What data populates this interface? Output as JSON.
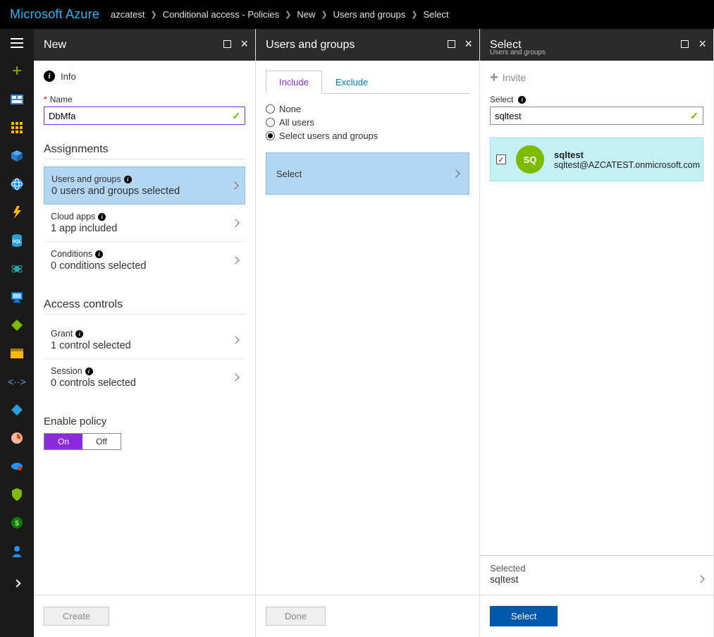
{
  "topbar": {
    "logo": "Microsoft Azure",
    "breadcrumbs": [
      "azcatest",
      "Conditional access - Policies",
      "New",
      "Users and groups",
      "Select"
    ]
  },
  "rail_icons": [
    "hamburger",
    "plus",
    "dashboard",
    "grid",
    "cube",
    "globe",
    "bolt",
    "sql",
    "monitor-dot",
    "screen",
    "diamond-green",
    "card",
    "code",
    "diamond-blue",
    "clock",
    "cloud",
    "shield",
    "target",
    "user",
    "expand"
  ],
  "blade_new": {
    "title": "New",
    "info_label": "Info",
    "name_label": "Name",
    "name_value": "DbMfa",
    "assignments_heading": "Assignments",
    "assign_items": [
      {
        "label": "Users and groups",
        "sub": "0 users and groups selected",
        "highlight": true
      },
      {
        "label": "Cloud apps",
        "sub": "1 app included",
        "highlight": false
      },
      {
        "label": "Conditions",
        "sub": "0 conditions selected",
        "highlight": false
      }
    ],
    "access_heading": "Access controls",
    "access_items": [
      {
        "label": "Grant",
        "sub": "1 control selected"
      },
      {
        "label": "Session",
        "sub": "0 controls selected"
      }
    ],
    "enable_heading": "Enable policy",
    "toggle_on": "On",
    "toggle_off": "Off",
    "create_btn": "Create"
  },
  "blade_ug": {
    "title": "Users and groups",
    "tab_include": "Include",
    "tab_exclude": "Exclude",
    "radio_none": "None",
    "radio_all": "All users",
    "radio_select": "Select users and groups",
    "select_card": "Select",
    "done_btn": "Done"
  },
  "blade_select": {
    "title": "Select",
    "subtitle": "Users and groups",
    "invite": "Invite",
    "search_label": "Select",
    "search_value": "sqltest",
    "result_initials": "SQ",
    "result_name": "sqltest",
    "result_email": "sqltest@AZCATEST.onmicrosoft.com",
    "selected_heading": "Selected",
    "selected_item": "sqltest",
    "select_btn": "Select"
  }
}
